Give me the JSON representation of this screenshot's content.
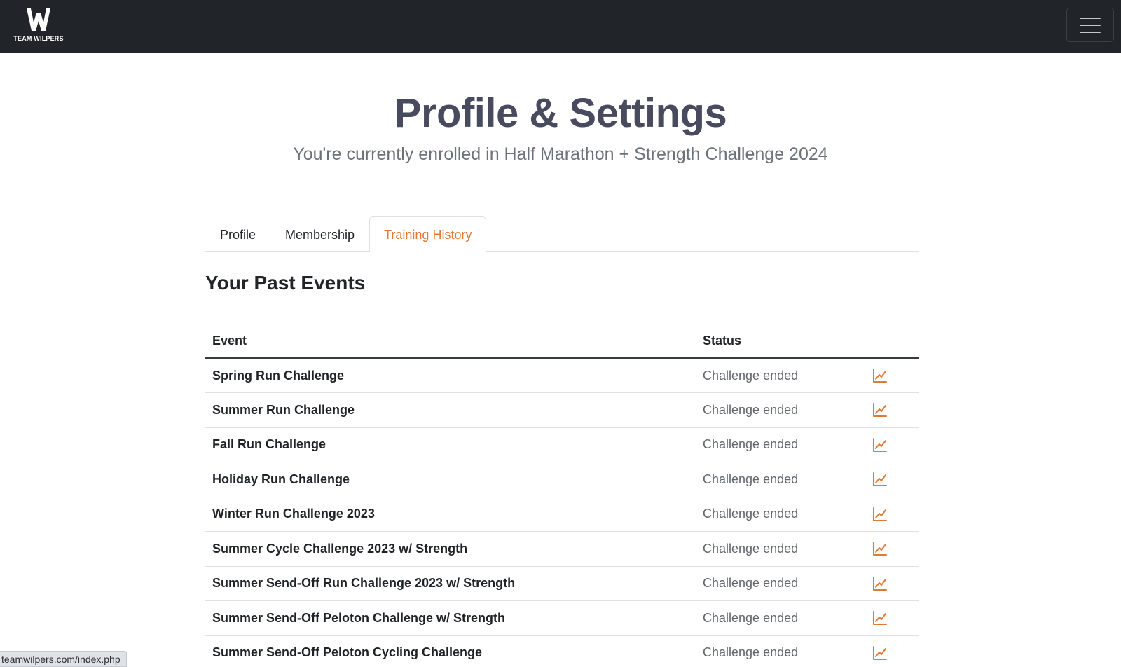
{
  "brand": {
    "logo_text": "TEAM WILPERS"
  },
  "header": {
    "title": "Profile & Settings",
    "subtitle": "You're currently enrolled in Half Marathon + Strength Challenge 2024"
  },
  "tabs": [
    {
      "label": "Profile",
      "active": false
    },
    {
      "label": "Membership",
      "active": false
    },
    {
      "label": "Training History",
      "active": true
    }
  ],
  "section": {
    "title": "Your Past Events"
  },
  "table": {
    "columns": [
      "Event",
      "Status",
      ""
    ],
    "rows": [
      {
        "event": "Spring Run Challenge",
        "status": "Challenge ended"
      },
      {
        "event": "Summer Run Challenge",
        "status": "Challenge ended"
      },
      {
        "event": "Fall Run Challenge",
        "status": "Challenge ended"
      },
      {
        "event": "Holiday Run Challenge",
        "status": "Challenge ended"
      },
      {
        "event": "Winter Run Challenge 2023",
        "status": "Challenge ended"
      },
      {
        "event": "Summer Cycle Challenge 2023 w/ Strength",
        "status": "Challenge ended"
      },
      {
        "event": "Summer Send-Off Run Challenge 2023 w/ Strength",
        "status": "Challenge ended"
      },
      {
        "event": "Summer Send-Off Peloton Challenge w/ Strength",
        "status": "Challenge ended"
      },
      {
        "event": "Summer Send-Off Peloton Cycling Challenge",
        "status": "Challenge ended"
      }
    ],
    "row_action_icon": "line-chart-icon"
  },
  "status_bar": {
    "url": "teamwilpers.com/index.php"
  },
  "colors": {
    "navbar": "#212428",
    "accent": "#e07a36",
    "title": "#484a5e",
    "subtitle": "#6c727c"
  }
}
